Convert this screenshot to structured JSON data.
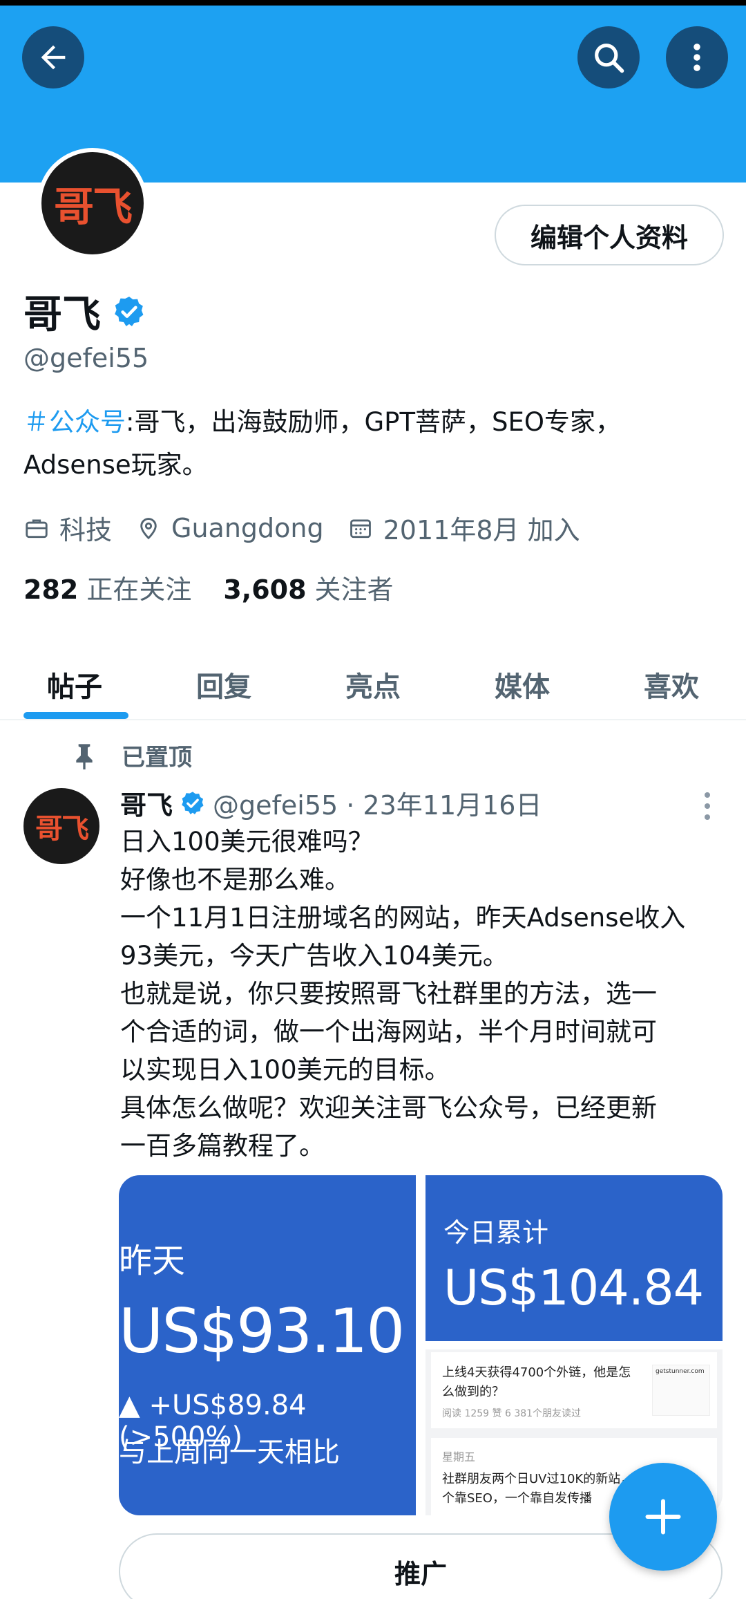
{
  "profile": {
    "avatar_text": "哥飞",
    "name": "哥飞",
    "handle": "@gefei55",
    "edit_button": "编辑个人资料",
    "bio_tag": "＃公众号",
    "bio_line1_rest": ":哥飞，出海鼓励师，GPT菩萨，SEO专家，",
    "bio_line2": "Adsense玩家。",
    "category": "科技",
    "location": "Guangdong",
    "joined": "2011年8月 加入",
    "following_count": "282",
    "following_label": "正在关注",
    "followers_count": "3,608",
    "followers_label": "关注者"
  },
  "tabs": [
    {
      "label": "帖子",
      "active": true
    },
    {
      "label": "回复",
      "active": false
    },
    {
      "label": "亮点",
      "active": false
    },
    {
      "label": "媒体",
      "active": false
    },
    {
      "label": "喜欢",
      "active": false
    }
  ],
  "post": {
    "pinned_label": "已置顶",
    "author": "哥飞",
    "handle_date": "@gefei55 · 23年11月16日",
    "lines": [
      "日入100美元很难吗？",
      "好像也不是那么难。",
      "一个11月1日注册域名的网站，昨天Adsense收入",
      "93美元，今天广告收入104美元。",
      "也就是说，你只要按照哥飞社群里的方法，选一",
      "个合适的词，做一个出海网站，半个月时间就可",
      "以实现日入100美元的目标。",
      "具体怎么做呢？欢迎关注哥飞公众号，已经更新",
      "一百多篇教程了。"
    ],
    "media": {
      "yesterday_label": "昨天",
      "yesterday_value": "US$93.10",
      "change_text": "▲ +US$89.84 (>500%)",
      "compare_text": "与上周同一天相比",
      "today_label": "今日累计",
      "today_value": "US$104.84",
      "card1_title": "上线4天获得4700个外链，他是怎么做到的？",
      "card1_meta": "阅读 1259   赞 6   381个朋友读过",
      "card1_thumb": "getstunner.com",
      "card2_day": "星期五",
      "card2_title": "社群朋友两个日UV过10K的新站，一个靠SEO，一个靠自发传播"
    },
    "promote_button": "推广"
  },
  "colors": {
    "banner": "#1da1f2",
    "accent": "#1d9bf0",
    "media_blue": "#2b63c9"
  }
}
